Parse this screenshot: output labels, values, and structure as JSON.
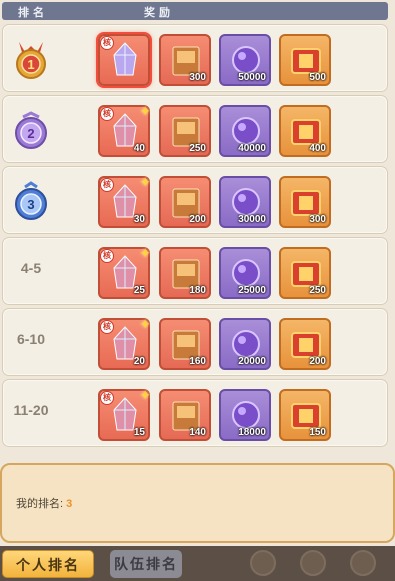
{
  "header": {
    "rank_col": "排名",
    "reward_col": "奖励"
  },
  "rows": [
    {
      "rank": "1",
      "rank_style": "gold-medal",
      "crystal": "",
      "book": "300",
      "orb": "50000",
      "ticket": "500"
    },
    {
      "rank": "2",
      "rank_style": "purple-medal",
      "crystal": "40",
      "book": "250",
      "orb": "40000",
      "ticket": "400"
    },
    {
      "rank": "3",
      "rank_style": "blue-medal",
      "crystal": "30",
      "book": "200",
      "orb": "30000",
      "ticket": "300"
    },
    {
      "rank": "4-5",
      "rank_style": "plain",
      "crystal": "25",
      "book": "180",
      "orb": "25000",
      "ticket": "250"
    },
    {
      "rank": "6-10",
      "rank_style": "plain",
      "crystal": "20",
      "book": "160",
      "orb": "20000",
      "ticket": "200"
    },
    {
      "rank": "11-20",
      "rank_style": "plain",
      "crystal": "15",
      "book": "140",
      "orb": "18000",
      "ticket": "150"
    }
  ],
  "item_badge": "核",
  "footer": {
    "my_rank_label": "我的排名:",
    "my_rank_value": "3"
  },
  "tabs": [
    {
      "label": "个人排名",
      "active": true
    },
    {
      "label": "队伍排名",
      "active": false
    }
  ],
  "colors": {
    "accent": "#e8942a",
    "header_bg": "#6f7790",
    "tab_active": "#f2b33c"
  },
  "icons": [
    "gold-medal-icon",
    "purple-medal-icon",
    "blue-medal-icon",
    "crystal-icon",
    "book-icon",
    "orb-icon",
    "ticket-icon",
    "star-icon"
  ]
}
